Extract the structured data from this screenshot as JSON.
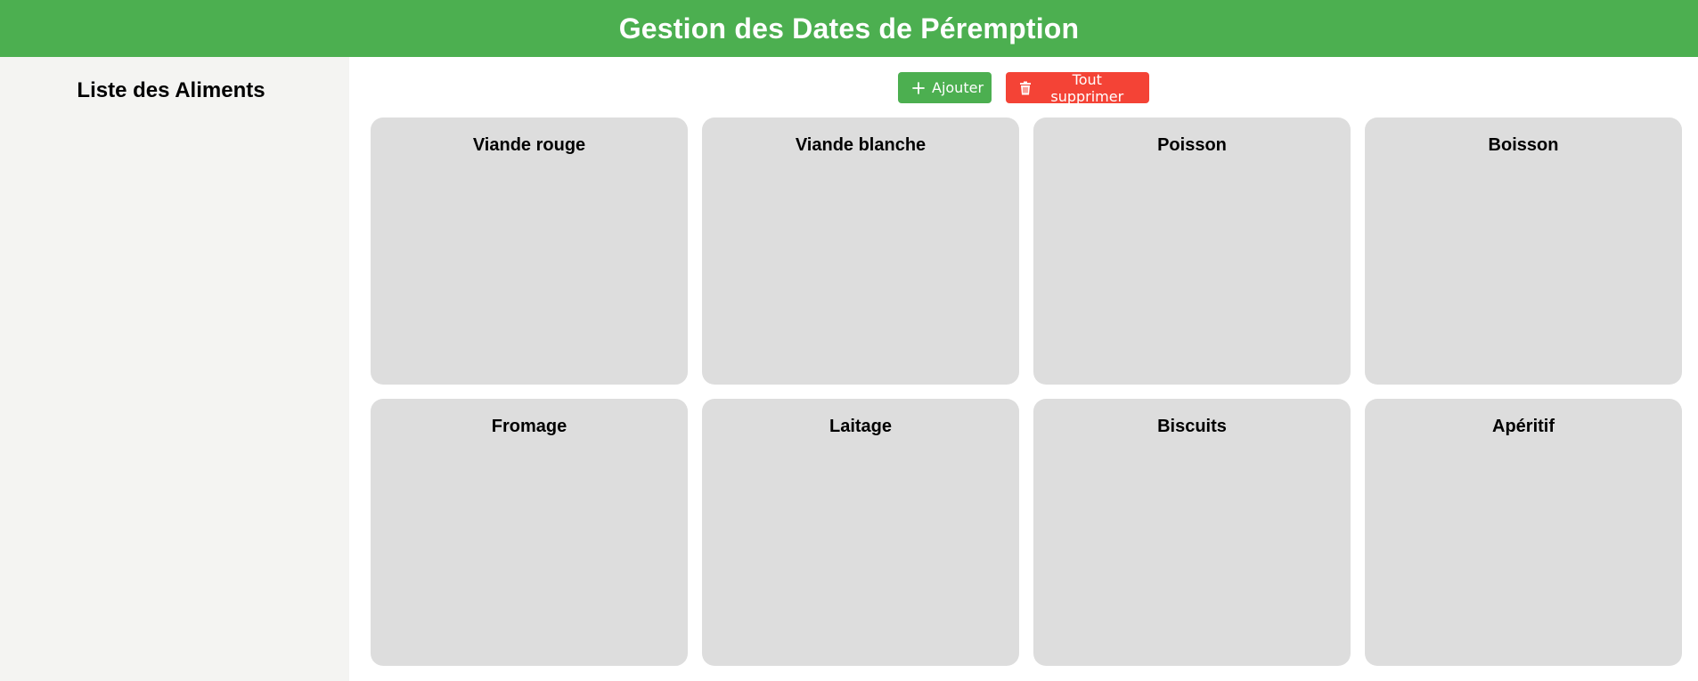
{
  "header": {
    "title": "Gestion des Dates de Péremption"
  },
  "sidebar": {
    "title": "Liste des Aliments"
  },
  "toolbar": {
    "add_label": "Ajouter",
    "add_icon": "plus-icon",
    "delete_all_label": "Tout supprimer",
    "delete_all_icon": "trash-icon"
  },
  "categories": [
    {
      "name": "Viande rouge"
    },
    {
      "name": "Viande blanche"
    },
    {
      "name": "Poisson"
    },
    {
      "name": "Boisson"
    },
    {
      "name": "Fromage"
    },
    {
      "name": "Laitage"
    },
    {
      "name": "Biscuits"
    },
    {
      "name": "Apéritif"
    }
  ],
  "colors": {
    "primary": "#4caf50",
    "danger": "#f44336",
    "card_bg": "#dddddd",
    "sidebar_bg": "#f4f4f2"
  }
}
